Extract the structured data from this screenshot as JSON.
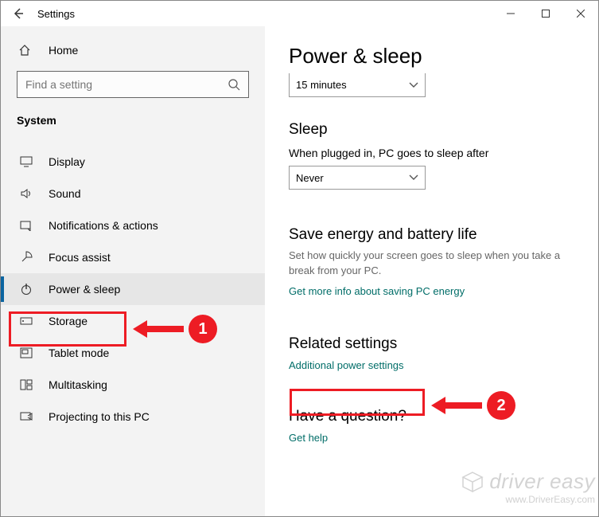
{
  "window": {
    "title": "Settings"
  },
  "sidebar": {
    "home": "Home",
    "search_placeholder": "Find a setting",
    "group": "System",
    "items": [
      {
        "label": "Display"
      },
      {
        "label": "Sound"
      },
      {
        "label": "Notifications & actions"
      },
      {
        "label": "Focus assist"
      },
      {
        "label": "Power & sleep"
      },
      {
        "label": "Storage"
      },
      {
        "label": "Tablet mode"
      },
      {
        "label": "Multitasking"
      },
      {
        "label": "Projecting to this PC"
      }
    ]
  },
  "content": {
    "heading": "Power & sleep",
    "screen_timeout_value": "15 minutes",
    "sleep_heading": "Sleep",
    "sleep_desc": "When plugged in, PC goes to sleep after",
    "sleep_value": "Never",
    "energy_heading": "Save energy and battery life",
    "energy_desc": "Set how quickly your screen goes to sleep when you take a break from your PC.",
    "energy_link": "Get more info about saving PC energy",
    "related_heading": "Related settings",
    "related_link": "Additional power settings",
    "question_heading": "Have a question?",
    "question_link": "Get help"
  },
  "annotations": {
    "step1": "1",
    "step2": "2"
  },
  "watermark": {
    "brand": "driver easy",
    "url": "www.DriverEasy.com"
  }
}
